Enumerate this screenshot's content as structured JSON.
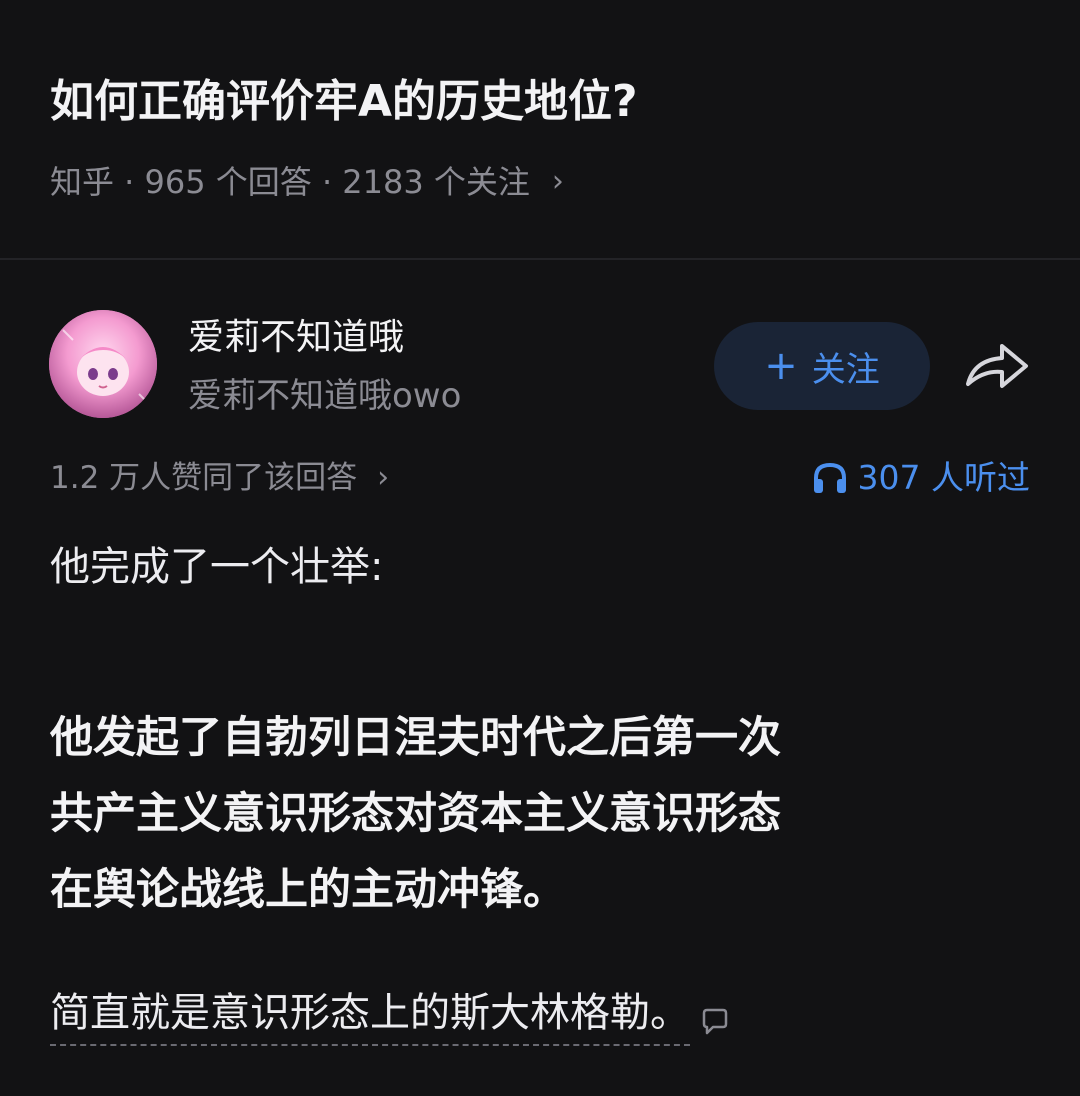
{
  "question": {
    "title": "如何正确评价牢A的历史地位?",
    "meta": "知乎 · 965 个回答 · 2183 个关注"
  },
  "author": {
    "name": "爱莉不知道哦",
    "handle": "爱莉不知道哦owo",
    "follow_label": "关注",
    "avatar_text": ""
  },
  "answer": {
    "upvote_summary": "1.2 万人赞同了该回答",
    "listen_count": "307 人听过",
    "paragraphs": [
      "他完成了一个壮举:",
      "他发起了自勃列日涅夫时代之后第一次",
      "共产主义意识形态对资本主义意识形态",
      "在舆论战线上的主动冲锋。",
      "简直就是意识形态上的斯大林格勒。"
    ]
  },
  "colors": {
    "background": "#121214",
    "accent": "#4b8fee",
    "muted_text": "#8b8b93"
  },
  "icons": [
    "chevron-right-icon",
    "plus-icon",
    "share-icon",
    "headphones-icon",
    "comment-icon"
  ]
}
